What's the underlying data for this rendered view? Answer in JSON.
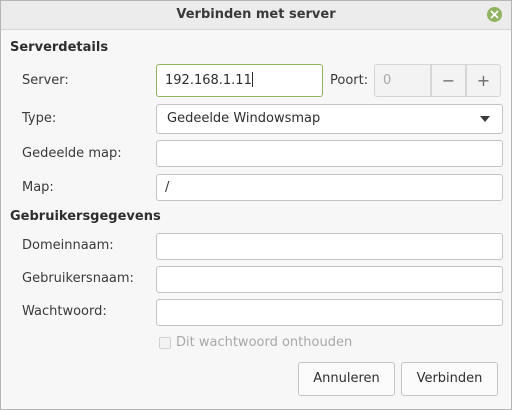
{
  "window": {
    "title": "Verbinden met server",
    "close_icon": "close-icon",
    "accent_color": "#8fb35f"
  },
  "server_details": {
    "header": "Serverdetails",
    "server_label": "Server:",
    "server_value": "192.168.1.11",
    "port_label": "Poort:",
    "port_value": "0",
    "port_decrement": "−",
    "port_increment": "+",
    "type_label": "Type:",
    "type_value": "Gedeelde Windowsmap",
    "shared_folder_label": "Gedeelde map:",
    "shared_folder_value": "",
    "folder_label": "Map:",
    "folder_value": "/"
  },
  "user_details": {
    "header": "Gebruikersgegevens",
    "domain_label": "Domeinnaam:",
    "domain_value": "",
    "username_label": "Gebruikersnaam:",
    "username_value": "",
    "password_label": "Wachtwoord:",
    "password_value": "",
    "remember_label": "Dit wachtwoord onthouden",
    "remember_checked": false
  },
  "buttons": {
    "cancel": "Annuleren",
    "connect": "Verbinden"
  }
}
